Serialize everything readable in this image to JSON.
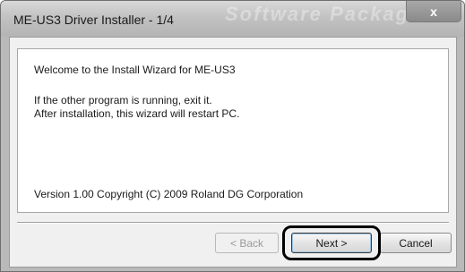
{
  "window": {
    "title": "ME-US3 Driver Installer - 1/4",
    "title_watermark": "Software Package",
    "close_symbol": "x"
  },
  "content": {
    "welcome": "Welcome to the Install Wizard for ME-US3",
    "instruction_1": "If the other program is running, exit it.",
    "instruction_2": "After installation, this wizard will restart PC.",
    "version_info": "Version 1.00  Copyright (C) 2009 Roland DG Corporation"
  },
  "buttons": {
    "back_label": "< Back",
    "back_enabled": false,
    "next_label": "Next >",
    "cancel_label": "Cancel"
  }
}
